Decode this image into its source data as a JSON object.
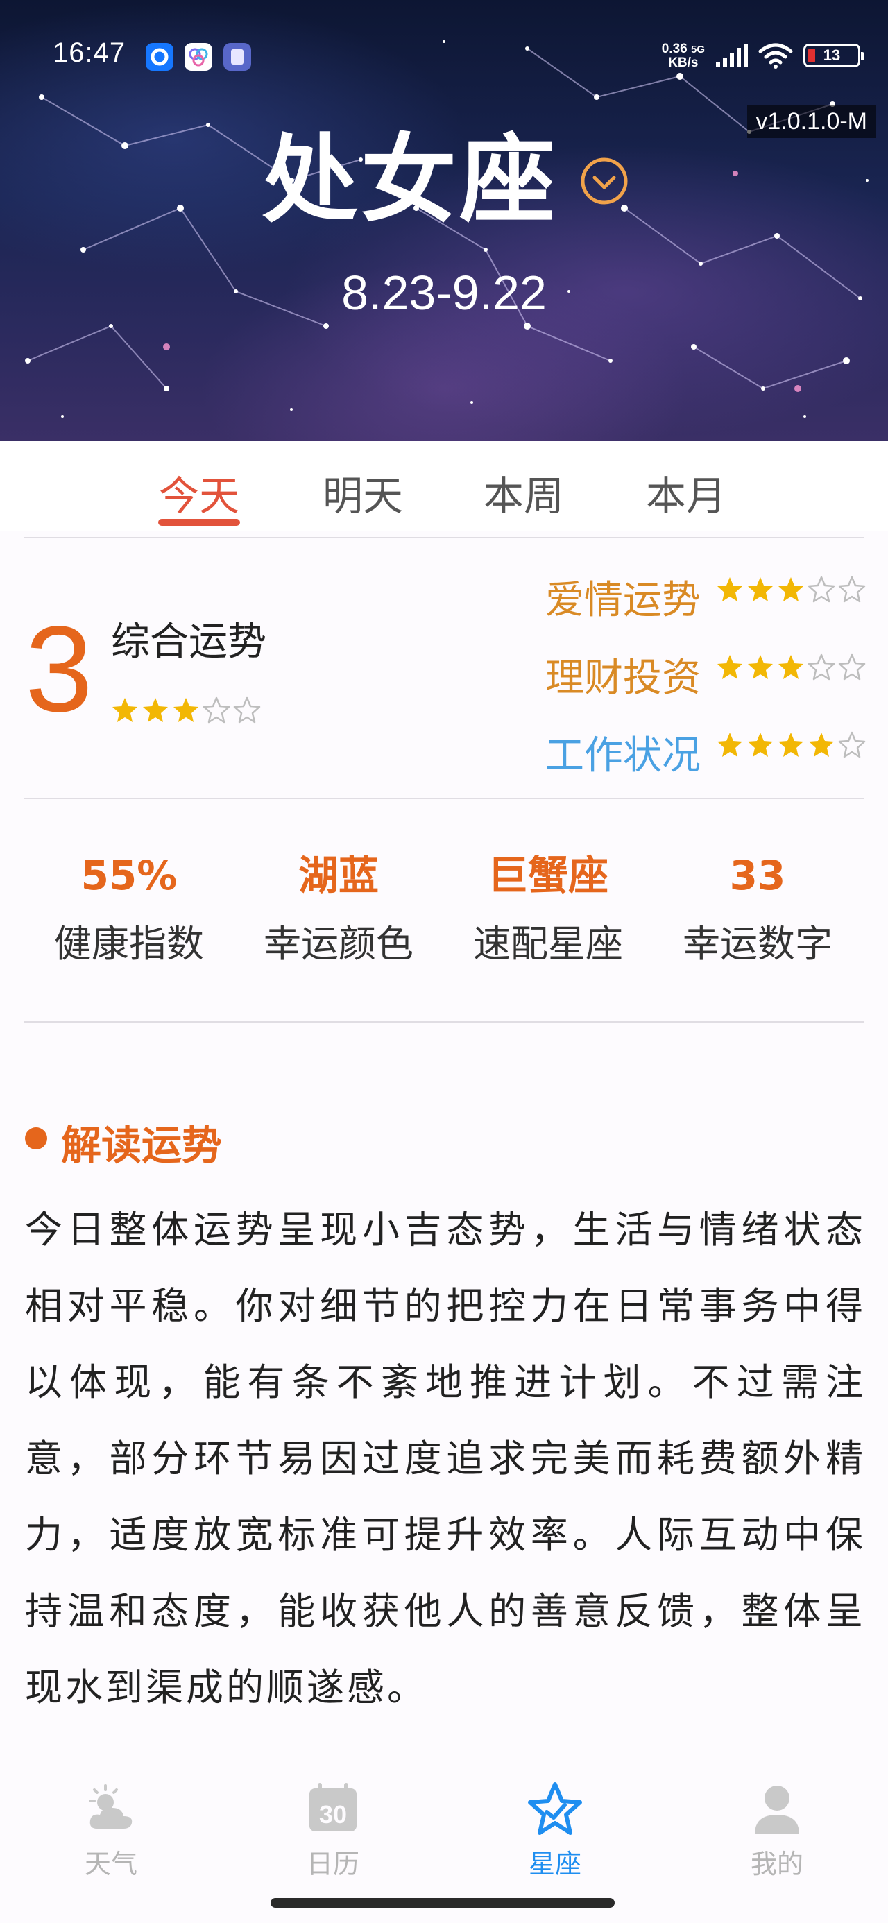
{
  "status_bar": {
    "time": "16:47",
    "net_speed_value": "0.36",
    "net_speed_unit": "KB/s",
    "network": "5G",
    "battery": "13"
  },
  "header": {
    "version": "v1.0.1.0-M",
    "sign_name": "处女座",
    "date_range": "8.23-9.22",
    "accent_color": "#f0a24a"
  },
  "tabs": [
    {
      "label": "今天",
      "active": true
    },
    {
      "label": "明天",
      "active": false
    },
    {
      "label": "本周",
      "active": false
    },
    {
      "label": "本月",
      "active": false
    }
  ],
  "overall": {
    "score": "3",
    "label": "综合运势",
    "stars": 3,
    "max_stars": 5
  },
  "aspects": [
    {
      "label": "爱情运势",
      "stars": 3,
      "max_stars": 5,
      "color": "#d98a25"
    },
    {
      "label": "理财投资",
      "stars": 3,
      "max_stars": 5,
      "color": "#d98a25"
    },
    {
      "label": "工作状况",
      "stars": 4,
      "max_stars": 5,
      "color": "#4aa1e3"
    }
  ],
  "stats": [
    {
      "value": "55%",
      "label": "健康指数"
    },
    {
      "value": "湖蓝",
      "label": "幸运颜色"
    },
    {
      "value": "巨蟹座",
      "label": "速配星座"
    },
    {
      "value": "33",
      "label": "幸运数字"
    }
  ],
  "reading": {
    "title": "解读运势",
    "text": "今日整体运势呈现小吉态势，生活与情绪状态相对平稳。你对细节的把控力在日常事务中得以体现，能有条不紊地推进计划。不过需注意，部分环节易因过度追求完美而耗费额外精力，适度放宽标准可提升效率。人际互动中保持温和态度，能收获他人的善意反馈，整体呈现水到渠成的顺遂感。"
  },
  "bottom_nav": [
    {
      "label": "天气",
      "icon": "weather-icon",
      "active": false
    },
    {
      "label": "日历",
      "icon": "calendar-icon",
      "active": false,
      "icon_text": "30"
    },
    {
      "label": "星座",
      "icon": "constellation-star-icon",
      "active": true
    },
    {
      "label": "我的",
      "icon": "profile-icon",
      "active": false
    }
  ],
  "colors": {
    "tab_active": "#e2533b",
    "score_orange": "#e5661c",
    "star_gold": "#f2b705",
    "nav_active": "#1f8ef0"
  }
}
